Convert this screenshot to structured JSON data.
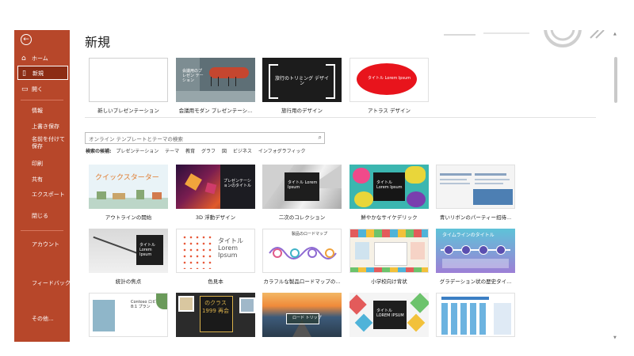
{
  "sidebar": {
    "items": [
      {
        "label": "ホーム",
        "icon": "home-icon"
      },
      {
        "label": "新規",
        "icon": "new-doc-icon",
        "active": true
      },
      {
        "label": "開く",
        "icon": "open-folder-icon"
      },
      {
        "label": "情報"
      },
      {
        "label": "上書き保存"
      },
      {
        "label": "名前を付けて保存"
      },
      {
        "label": "印刷"
      },
      {
        "label": "共有"
      },
      {
        "label": "エクスポート"
      },
      {
        "label": "閉じる"
      },
      {
        "label": "アカウント"
      },
      {
        "label": "フィードバック"
      },
      {
        "label": "その他..."
      }
    ]
  },
  "header": {
    "title": "新規"
  },
  "featured": [
    {
      "caption": "新しいプレゼンテーション"
    },
    {
      "caption": "会議用モダン プレゼンテーシ...",
      "thumb_text": "会議用のプレゼン テーション"
    },
    {
      "caption": "旅行用のデザイン",
      "thumb_text": "旅行のトリミング デザイン"
    },
    {
      "caption": "アトラス デザイン",
      "thumb_text": "タイトル Lorem Ipsum"
    }
  ],
  "search": {
    "placeholder": "オンライン テンプレートとテーマの検索",
    "suggest_label": "検索の候補:",
    "suggestions": [
      "プレゼンテーション",
      "テーマ",
      "教育",
      "グラフ",
      "図",
      "ビジネス",
      "インフォグラフィック"
    ]
  },
  "templates": [
    {
      "caption": "アウトラインの開始",
      "thumb_text": "クイックスターター"
    },
    {
      "caption": "3D 浮動デザイン",
      "thumb_text": "プレゼンテーションのタイトル"
    },
    {
      "caption": "二次のコレクション",
      "thumb_text": "タイトル Lorem Ipsum"
    },
    {
      "caption": "鮮やかなサイケデリック",
      "thumb_text": "タイトル Lorem Ipsum"
    },
    {
      "caption": "青いリボンのパーティー招待...",
      "thumb_text": ""
    },
    {
      "caption": "統計の焦点",
      "thumb_text": "タイトル Lorem Ipsum"
    },
    {
      "caption": "色見本",
      "thumb_text": "タイトル Lorem Ipsum"
    },
    {
      "caption": "カラフルな製品ロードマップの...",
      "thumb_text": "製品のロードマップ"
    },
    {
      "caption": "小学校向け背状",
      "thumb_text": ""
    },
    {
      "caption": "グラデーション状の歴史タイ...",
      "thumb_text": "タイムラインのタイトル"
    },
    {
      "caption": "",
      "thumb_text": "Contoso ロビン 8:1 プラン"
    },
    {
      "caption": "",
      "thumb_text": "のクラス 1999 再会"
    },
    {
      "caption": "",
      "thumb_text": "ロード トリップ"
    },
    {
      "caption": "",
      "thumb_text": "タイトル LOREM IPSUM"
    },
    {
      "caption": "",
      "thumb_text": ""
    }
  ],
  "colors": {
    "accent": "#b7472a",
    "accent_active": "#8c2c14"
  }
}
